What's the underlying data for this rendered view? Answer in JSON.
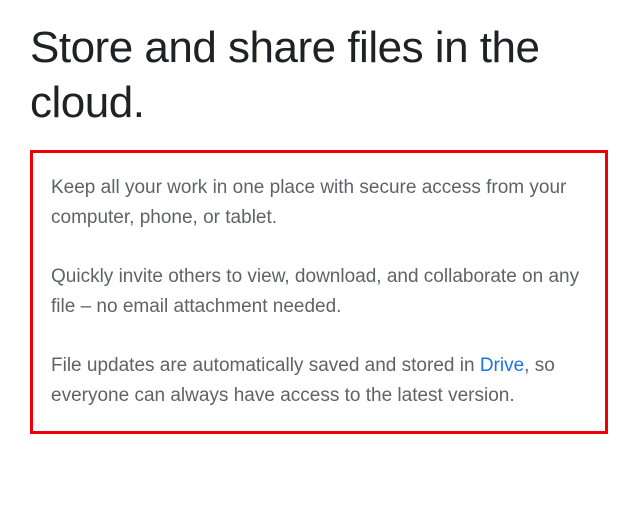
{
  "heading": "Store and share files in the cloud.",
  "paragraphs": {
    "p1": "Keep all your work in one place with secure access from your computer, phone, or tablet.",
    "p2": "Quickly invite others to view, download, and collaborate on any file – no email attachment needed.",
    "p3_before": "File updates are automatically saved and stored in ",
    "p3_link": "Drive",
    "p3_after": ", so everyone can always have access to the latest version."
  }
}
